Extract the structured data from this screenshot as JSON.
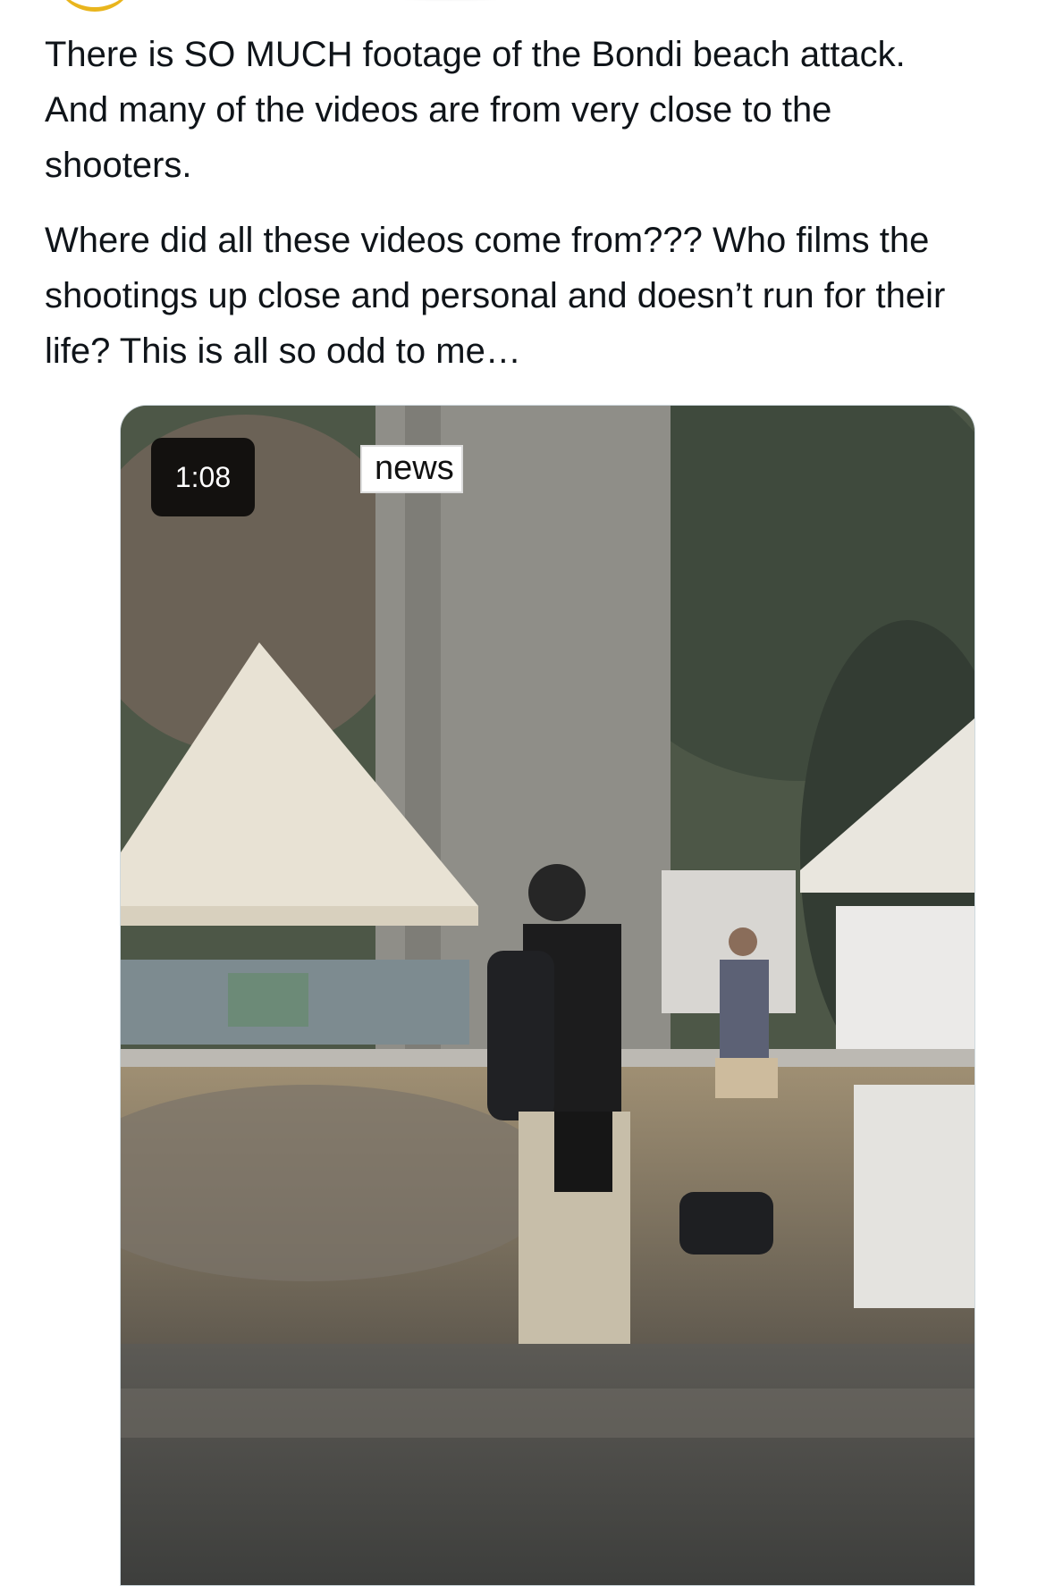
{
  "post": {
    "paragraphs": [
      "There is SO MUCH footage of the Bondi beach attack.\nAnd many of the videos are from very close to the\nshooters.",
      "Where did all these videos come from???  Who films the\nshootings up close and personal and doesn’t run for their\nlife? This is all so odd to me…"
    ]
  },
  "video": {
    "duration": "1:08",
    "watermark": "news"
  },
  "colors": {
    "text": "#0f1419",
    "avatar_ring": "#e9b51d",
    "badge_bg": "#000000"
  }
}
